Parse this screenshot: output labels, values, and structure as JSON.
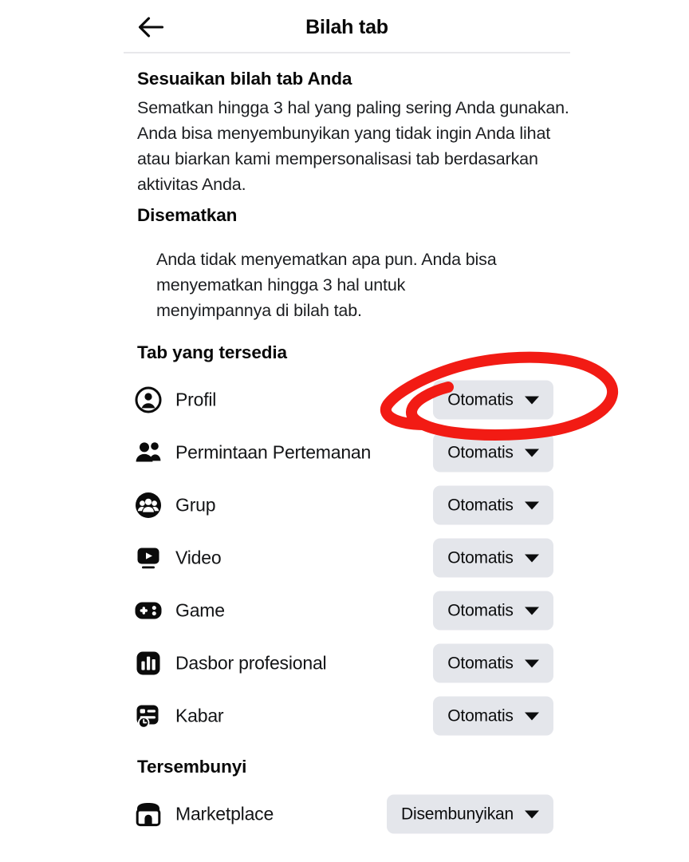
{
  "header": {
    "back_icon": "arrow-left-icon",
    "title": "Bilah tab"
  },
  "sections": {
    "customize": {
      "title": "Sesuaikan bilah tab Anda",
      "description": "Sematkan hingga 3 hal yang paling sering Anda gunakan. Anda bisa menyembunyikan yang tidak ingin Anda lihat atau biarkan kami mempersonalisasi tab berdasarkan aktivitas Anda."
    },
    "pinned": {
      "title": "Disematkan",
      "description": "Anda tidak menyematkan apa pun. Anda bisa menyematkan hingga 3 hal untuk menyimpannya di bilah tab."
    },
    "available": {
      "title": "Tab yang tersedia"
    },
    "hidden": {
      "title": "Tersembunyi"
    }
  },
  "available_tabs": [
    {
      "label": "Profil",
      "icon": "profile-icon",
      "status": "Otomatis"
    },
    {
      "label": "Permintaan Pertemanan",
      "icon": "friends-icon",
      "status": "Otomatis"
    },
    {
      "label": "Grup",
      "icon": "groups-icon",
      "status": "Otomatis"
    },
    {
      "label": "Video",
      "icon": "video-icon",
      "status": "Otomatis"
    },
    {
      "label": "Game",
      "icon": "gamepad-icon",
      "status": "Otomatis"
    },
    {
      "label": "Dasbor profesional",
      "icon": "dashboard-icon",
      "status": "Otomatis"
    },
    {
      "label": "Kabar",
      "icon": "news-icon",
      "status": "Otomatis"
    }
  ],
  "hidden_tabs": [
    {
      "label": "Marketplace",
      "icon": "marketplace-icon",
      "status": "Disembunyikan"
    }
  ],
  "annotation": {
    "shape": "hand-drawn-circle",
    "color": "#f21b14",
    "targets": "Profil status dropdown"
  },
  "colors": {
    "pill_background": "#e4e6eb",
    "text_primary": "#050505",
    "divider": "#e8e8eb",
    "annotation_red": "#f21b14"
  }
}
